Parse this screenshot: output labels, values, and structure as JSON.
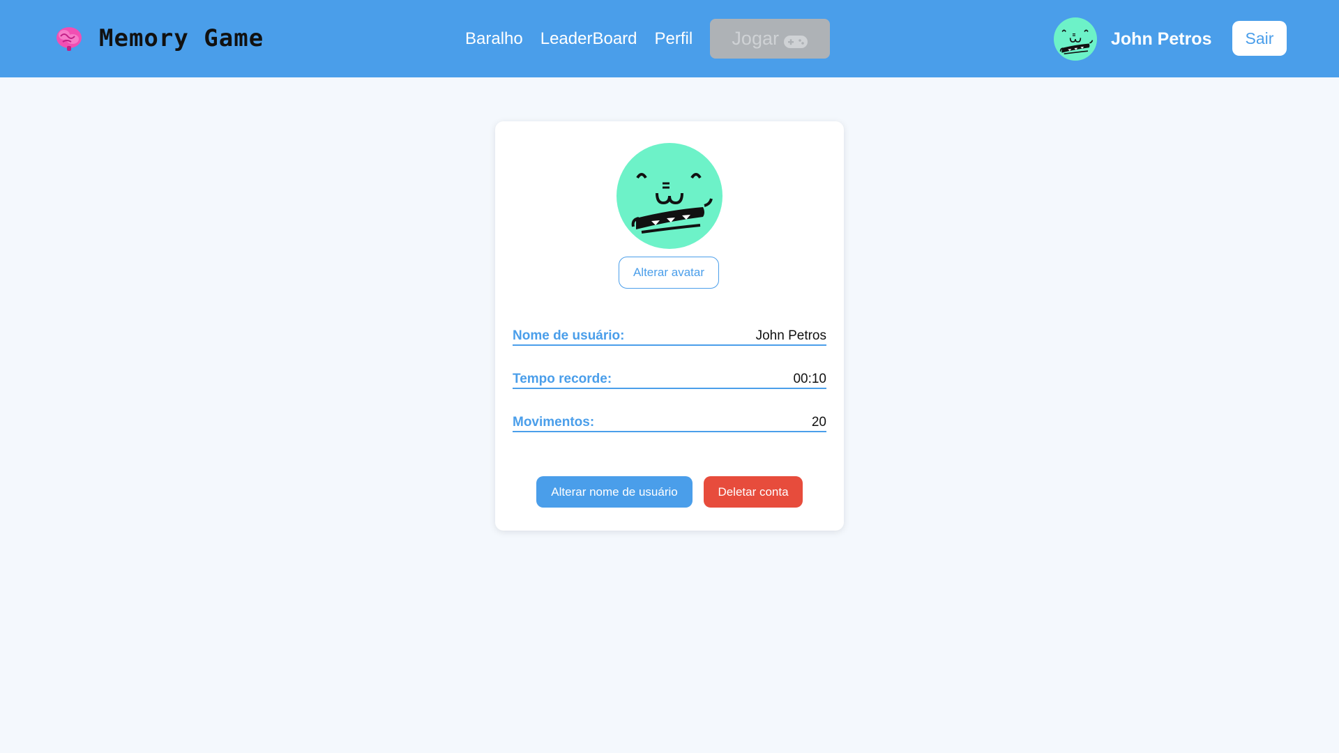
{
  "header": {
    "brand_title": "Memory Game",
    "brand_icon": "brain-icon",
    "nav": {
      "deck": "Baralho",
      "leaderboard": "LeaderBoard",
      "profile": "Perfil",
      "play": "Jogar"
    },
    "play_icon": "gamepad-icon",
    "user_name": "John Petros",
    "logout": "Sair"
  },
  "profile": {
    "change_avatar": "Alterar avatar",
    "fields": [
      {
        "label": "Nome de usuário:",
        "value": "John Petros"
      },
      {
        "label": "Tempo recorde:",
        "value": "00:10"
      },
      {
        "label": "Movimentos:",
        "value": "20"
      }
    ],
    "rename_button": "Alterar nome de usuário",
    "delete_button": "Deletar conta"
  },
  "colors": {
    "primary": "#4a9eea",
    "danger": "#e74c3c",
    "avatar_bg": "#6df2c8",
    "background": "#f4f8fd",
    "disabled": "#aeb2b6"
  }
}
